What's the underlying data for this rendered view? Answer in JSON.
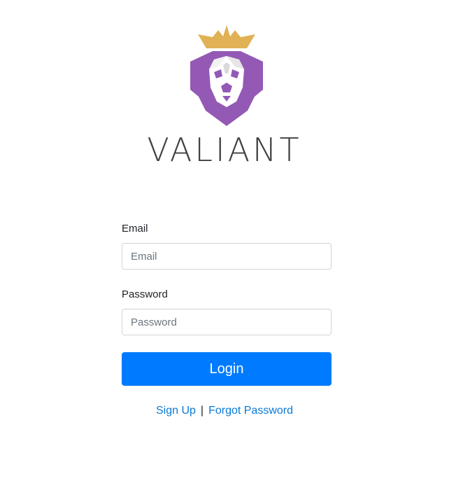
{
  "brand": {
    "name": "VALIANT",
    "logo_icon": "crowned-lion-icon",
    "colors": {
      "crown": "#e0b255",
      "mane": "#9459b5",
      "face": "#ffffff"
    }
  },
  "form": {
    "email": {
      "label": "Email",
      "placeholder": "Email",
      "value": ""
    },
    "password": {
      "label": "Password",
      "placeholder": "Password",
      "value": ""
    },
    "login_label": "Login"
  },
  "links": {
    "sign_up": "Sign Up",
    "separator": "|",
    "forgot_password": "Forgot Password"
  },
  "colors": {
    "primary": "#007bff",
    "link": "#0a7ad6"
  }
}
